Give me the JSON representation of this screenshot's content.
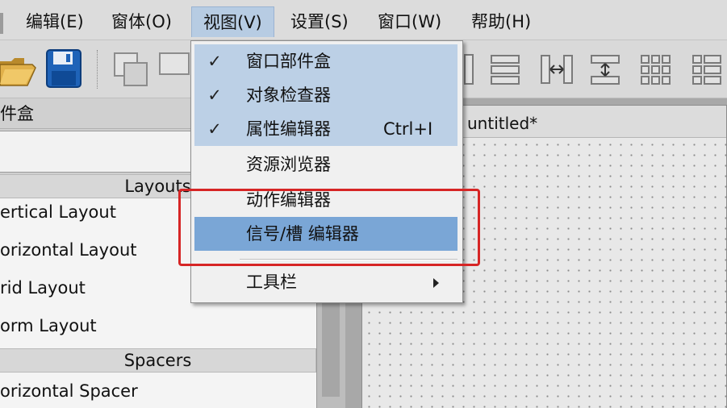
{
  "menubar": {
    "items": [
      {
        "label": "编辑(E)",
        "key": "edit"
      },
      {
        "label": "窗体(O)",
        "key": "form"
      },
      {
        "label": "视图(V)",
        "key": "view"
      },
      {
        "label": "设置(S)",
        "key": "settings"
      },
      {
        "label": "窗口(W)",
        "key": "window"
      },
      {
        "label": "帮助(H)",
        "key": "help"
      }
    ]
  },
  "view_menu": {
    "items": [
      {
        "label": "窗口部件盒",
        "checked": true,
        "shortcut": ""
      },
      {
        "label": "对象检查器",
        "checked": true,
        "shortcut": ""
      },
      {
        "label": "属性编辑器",
        "checked": true,
        "shortcut": "Ctrl+I"
      },
      {
        "label": "资源浏览器",
        "checked": false,
        "shortcut": ""
      },
      {
        "label": "动作编辑器",
        "checked": false,
        "shortcut": ""
      },
      {
        "label": "信号/槽 编辑器",
        "checked": false,
        "shortcut": "",
        "highlighted": true
      },
      {
        "label": "工具栏",
        "checked": false,
        "shortcut": "",
        "submenu": true
      }
    ],
    "check_glyph": "✓"
  },
  "widget_box": {
    "title": "件盒",
    "categories": [
      {
        "name": "Layouts",
        "items": [
          "ertical Layout",
          "orizontal Layout",
          "rid Layout",
          "orm Layout"
        ]
      },
      {
        "name": "Spacers",
        "items": [
          "orizontal Spacer"
        ]
      }
    ]
  },
  "form_window": {
    "title": "untitled*"
  },
  "colors": {
    "menu_active": "#b7cce3",
    "item_highlight": "#7aa6d6",
    "annotation": "#d62525"
  }
}
